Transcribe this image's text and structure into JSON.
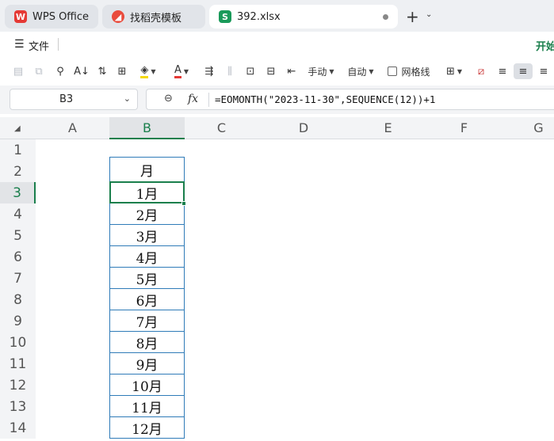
{
  "tabs": [
    {
      "label": "WPS Office"
    },
    {
      "label": "找稻壳模板"
    },
    {
      "label": "392.xlsx"
    }
  ],
  "menu": {
    "file_label": "文件",
    "start_label": "开始"
  },
  "toolbar": {
    "manual_label": "手动",
    "auto_label": "自动",
    "gridlines_label": "网格线"
  },
  "formula_bar": {
    "cell_ref": "B3",
    "formula": "=EOMONTH(\"2023-11-30\",SEQUENCE(12))+1"
  },
  "columns": [
    "A",
    "B",
    "C",
    "D",
    "E",
    "F",
    "G"
  ],
  "selected_column": "B",
  "rows": [
    "1",
    "2",
    "3",
    "4",
    "5",
    "6",
    "7",
    "8",
    "9",
    "10",
    "11",
    "12",
    "13",
    "14"
  ],
  "selected_row": "3",
  "cells": {
    "B2": "月",
    "B3": "1月",
    "B4": "2月",
    "B5": "3月",
    "B6": "4月",
    "B7": "5月",
    "B8": "6月",
    "B9": "7月",
    "B10": "8月",
    "B11": "9月",
    "B12": "10月",
    "B13": "11月",
    "B14": "12月"
  },
  "colors": {
    "accent": "#1a7f4c",
    "table_border": "#2f7bb8",
    "wps_red": "#e53935"
  }
}
